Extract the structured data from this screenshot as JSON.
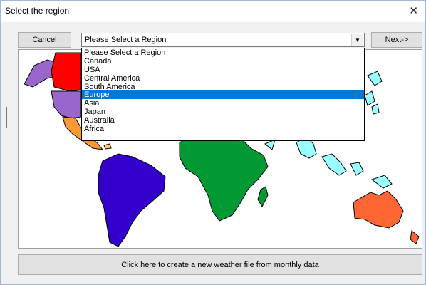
{
  "window": {
    "title": "Select the region"
  },
  "toolbar": {
    "cancel_label": "Cancel",
    "next_label": "Next->",
    "region_select_value": "Please Select a Region"
  },
  "dropdown": {
    "options": [
      "Please Select a Region",
      "Canada",
      "USA",
      "Central America",
      "South America",
      "Europe",
      "Asia",
      "Japan",
      "Australia",
      "Africa"
    ],
    "highlighted": "Europe"
  },
  "footer": {
    "create_weather_label": "Click here to create a new weather file from monthly data"
  },
  "colors": {
    "highlight": "#0078d7",
    "canada": "#9966cc",
    "usa": "#ff0000",
    "central_america": "#ff9933",
    "south_america": "#3300cc",
    "africa": "#009933",
    "asia": "#99ffff",
    "australia": "#ff6633"
  }
}
